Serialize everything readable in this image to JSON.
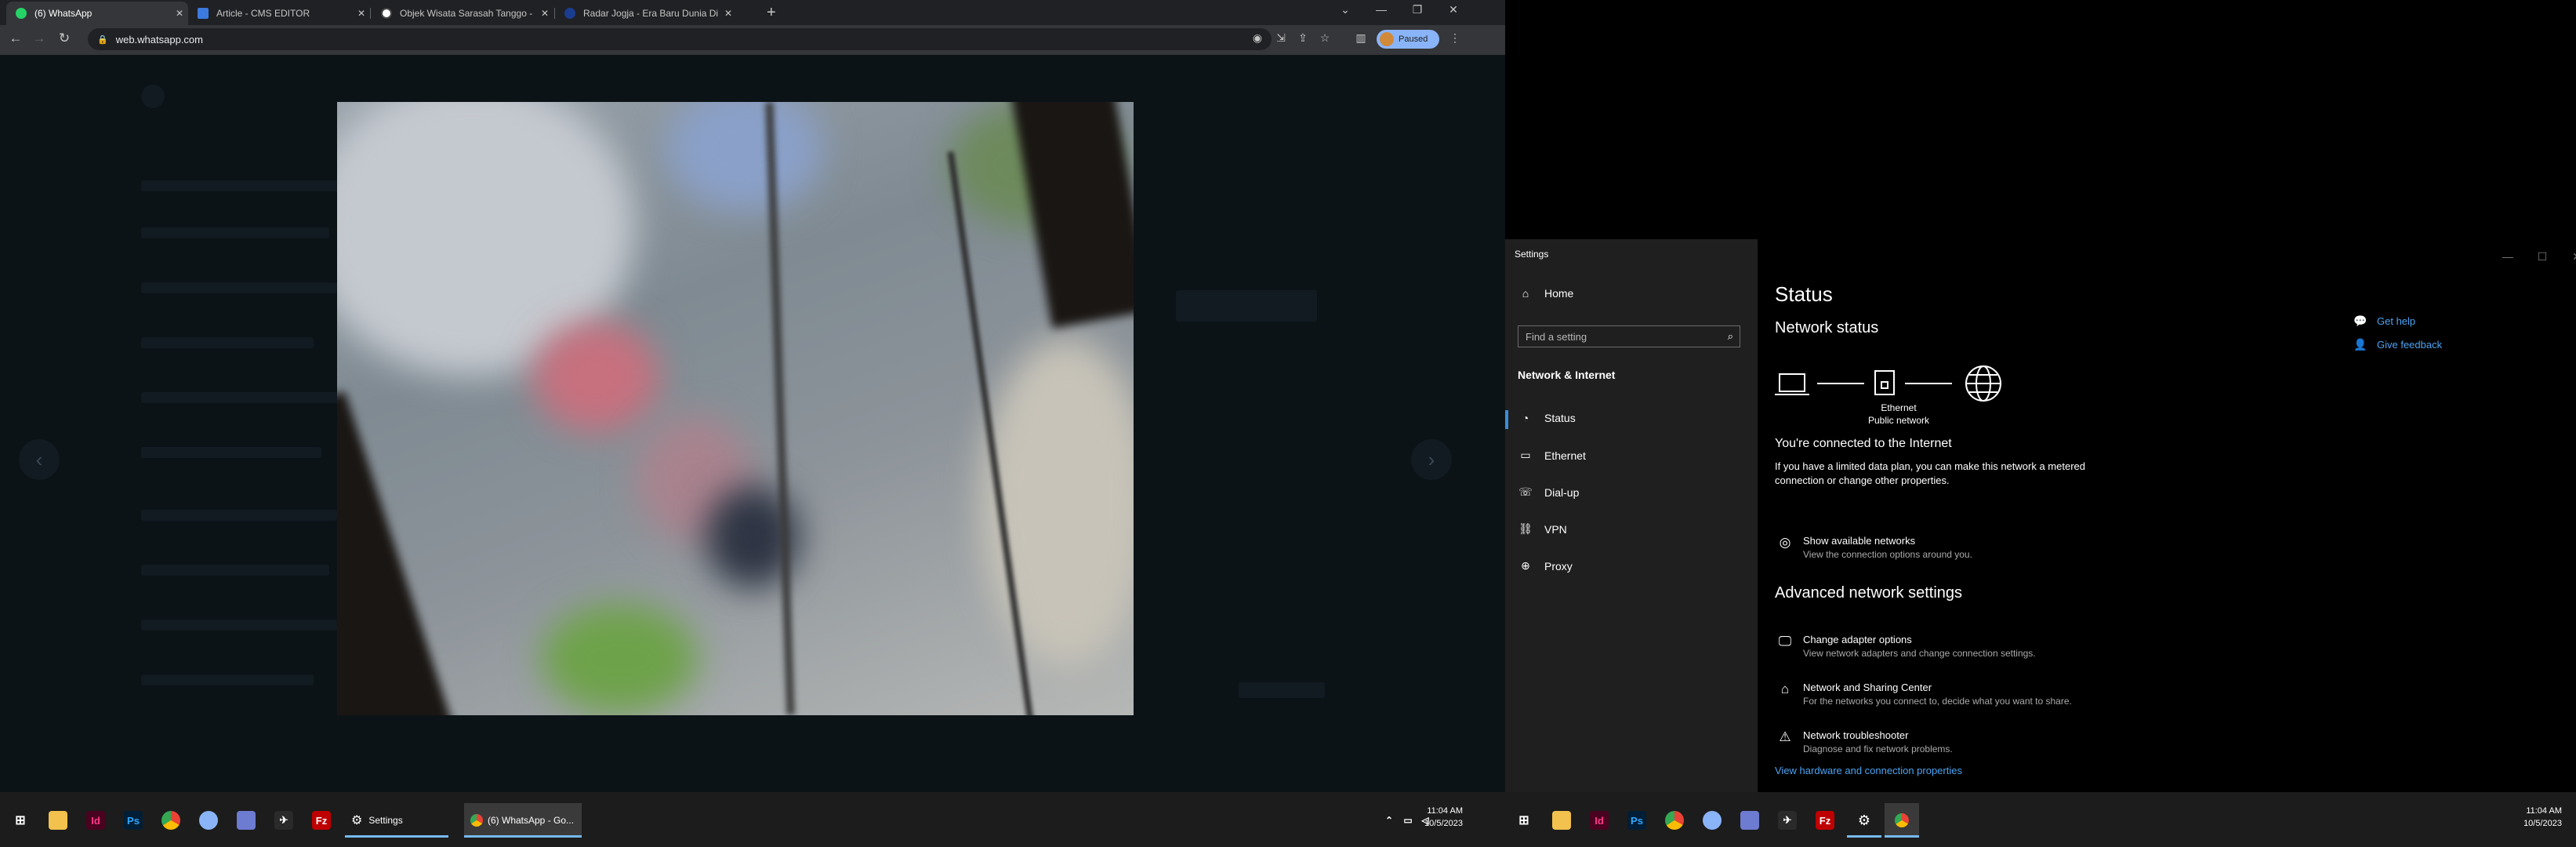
{
  "browser": {
    "tabs": [
      {
        "title": "(6) WhatsApp",
        "color": "#25d366",
        "active": true
      },
      {
        "title": "Article - CMS EDITOR",
        "color": "#3c7ae0",
        "active": false
      },
      {
        "title": "Objek Wisata Sarasah Tanggo -",
        "color": "#ffffff",
        "active": false
      },
      {
        "title": "Radar Jogja - Era Baru Dunia Di",
        "color": "#1a3d8f",
        "active": false
      }
    ],
    "new_tab": "+",
    "url": "web.whatsapp.com",
    "profile_status": "Paused"
  },
  "viewer": {
    "prev": "‹",
    "next": "›"
  },
  "taskbar_left": {
    "apps": [
      {
        "icon": "folder-icon",
        "color": "#f2c14e",
        "glyph": ""
      },
      {
        "icon": "indesign-icon",
        "color": "#49021f",
        "glyph": "Id"
      },
      {
        "icon": "photoshop-icon",
        "color": "#001e36",
        "glyph": "Ps"
      },
      {
        "icon": "chrome-icon",
        "color": "#ffffff",
        "glyph": ""
      },
      {
        "icon": "gear-app-icon",
        "color": "#8ab4f8",
        "glyph": ""
      },
      {
        "icon": "calculator-icon",
        "color": "#6d7bd1",
        "glyph": ""
      },
      {
        "icon": "acrobat-icon",
        "color": "#2a2a2a",
        "glyph": ""
      },
      {
        "icon": "filezilla-icon",
        "color": "#bf0000",
        "glyph": "Fz"
      }
    ],
    "open_settings": "Settings",
    "open_whatsapp": "(6) WhatsApp - Go...",
    "time": "11:04 AM",
    "date": "10/5/2023"
  },
  "settings": {
    "app_title": "Settings",
    "home": "Home",
    "search_placeholder": "Find a setting",
    "section": "Network & Internet",
    "nav": [
      {
        "label": "Status",
        "icon": "status-icon"
      },
      {
        "label": "Ethernet",
        "icon": "ethernet-icon"
      },
      {
        "label": "Dial-up",
        "icon": "dialup-icon"
      },
      {
        "label": "VPN",
        "icon": "vpn-icon"
      },
      {
        "label": "Proxy",
        "icon": "proxy-icon"
      }
    ],
    "page_title": "Status",
    "network_status_heading": "Network status",
    "ethernet_label": "Ethernet",
    "network_type": "Public network",
    "connected_title": "You're connected to the Internet",
    "connected_desc": "If you have a limited data plan, you can make this network a metered connection or change other properties.",
    "show_networks": {
      "title": "Show available networks",
      "sub": "View the connection options around you."
    },
    "advanced_heading": "Advanced network settings",
    "advanced": [
      {
        "title": "Change adapter options",
        "sub": "View network adapters and change connection settings."
      },
      {
        "title": "Network and Sharing Center",
        "sub": "For the networks you connect to, decide what you want to share."
      },
      {
        "title": "Network troubleshooter",
        "sub": "Diagnose and fix network problems."
      }
    ],
    "hardware_link": "View hardware and connection properties",
    "get_help": "Get help",
    "give_feedback": "Give feedback"
  },
  "taskbar_right": {
    "time": "11:04 AM",
    "date": "10/5/2023"
  }
}
